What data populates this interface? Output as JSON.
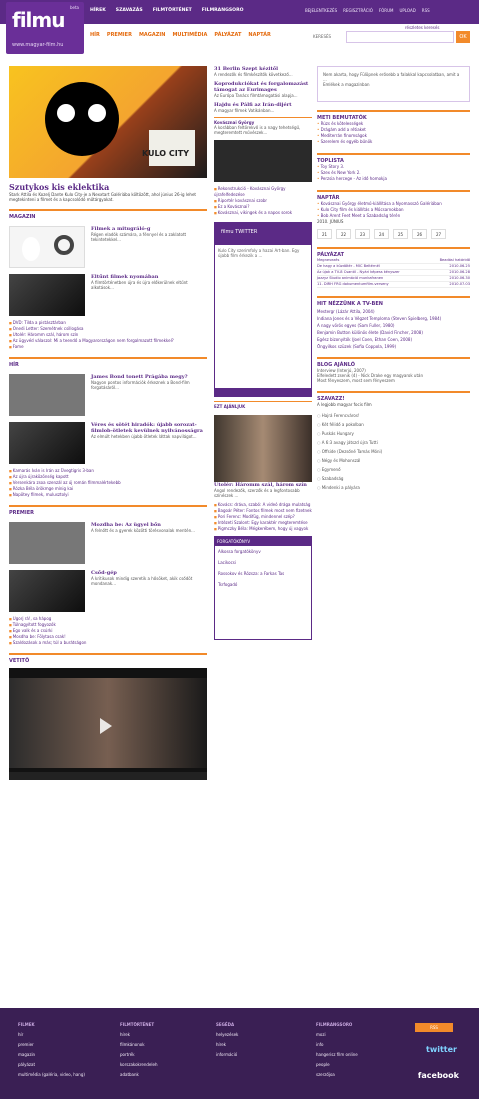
{
  "header": {
    "logo": "filmu",
    "logo_sub": "www.magyar-film.hu",
    "logo_small": "beta",
    "top_nav": [
      "HÍREK",
      "SZAVAZÁS",
      "FILMTÖRTÉNET",
      "FILMRANGSORO"
    ],
    "top_links": [
      "BEJELENTKEZÉS",
      "REGISZTRÁCIÓ",
      "FÓRUM",
      "UPLOAD",
      "RSS"
    ],
    "sub_nav": [
      "HÍR",
      "PREMIER",
      "MAGAZIN",
      "MULTIMÉDIA",
      "PÁLYÁZAT",
      "NAPTÁR"
    ],
    "search_label": "KERESÉS",
    "search_placeholder": "",
    "go": "OK",
    "mini": "részletes keresés"
  },
  "main": {
    "hero_tag": "KULO CITY",
    "hero_title": "Szutykos kis eklektika",
    "hero_text": "Stark Attila és Kozelj Dante Kulo City-je a Nexxtart Galériába költözött, ahol június 26-ig lehet megtekinteni a filmet és a kapcsolódó műtárgyakat.",
    "sec_magazin": "MAGAZIN",
    "magazin_items": [
      {
        "title": "Filmek a mitugráló-g",
        "text": "Régen eladók számára, a fénnyel és a zaklatott tekintetekkel..."
      },
      {
        "title": "Eltűnt filmek nyomában",
        "text": "A filmtörténetben újra és újra előkerülnek eltűnt alkotások..."
      }
    ],
    "magazin_list": [
      "DVD: Tilda a pistásztárban",
      "Onedi Letter: Szemétnek csillogása",
      "Utolér: Háromm szál, három szín",
      "Az ügyvéd válaszol: Mi a teendő a Magyarországon nem forgalmazott filmekkel?",
      "Fame"
    ],
    "sec_hir": "HÍR",
    "hir_items": [
      {
        "title": "James Bond tonett Prágába megy?",
        "text": "Nagyon pontos információk érkeznek a Bond-film forgatásáról..."
      },
      {
        "title": "Véres és sötét hiradók: újabb sorozat-filmlob-ötletek kevülnek nyilvánosságra",
        "text": "Az elmúlt hetekben újabb ötletek láttak napvilágot..."
      }
    ],
    "hir_list": [
      "Kamarás Iván is Irán az Üvegtigris 3-ban",
      "Az újra újraközönség kapott",
      "Versenkára zsoa szenzál az új román filmmalértekebb",
      "Rózka Béla örökmge mínig kai",
      "Napötey filmek, mulusztolyi"
    ],
    "sec_premier": "PREMIER",
    "premier_items": [
      {
        "title": "Mozdha be: Az ügyel bőn",
        "text": "A felnőtt és a gyerek közötti törésvonalak mentén..."
      },
      {
        "title": "Csőd-gép",
        "text": "A kritikusok mindig szeretik a hősöket, akik csődöt mondanak..."
      }
    ],
    "premier_list": [
      "Ugorj rá!, sa hápog",
      "Túlnagyított fogyozók",
      "Ego valk és a csúrki",
      "Mosdha be: Fölytasa csak!",
      "Szaldozások a más; túl a burátságon"
    ],
    "sec_video": "VETITŐ",
    "video_tag": "filmu TV"
  },
  "col2": {
    "hero_title": "Kovásznai György",
    "hero_text": "A korábban feltörekvő is a nagy tehetségű, megteremtett művészek...",
    "stories": [
      {
        "title": "31 Berlin Szept kézitől",
        "text": "A rendezők és filmkészítők következő..."
      },
      {
        "title": "Koprodukciókat és forgalomazást támogat az Eurimages",
        "text": "Az Európa Tanács filmtámogatási alapja..."
      },
      {
        "title": "Hajdu és Pálfi az Irán-dijért",
        "text": "A magyar filmek Vatikánban..."
      }
    ],
    "kovacsnai_list": [
      "Rekonstrukció - Kovásznai György újrafelfedezése",
      "Riportér kovásznai szobr",
      "Ez a Kovásznai?",
      "Kovásznai, vikingek és a napos sorok"
    ],
    "twitter_header": "filmu TWITTER",
    "twitter_text": "Kulo City szerimfoly a hazai Art-ban. Egy újabb film érkezik a ...",
    "sec_ezt_ajanljuk": "EZT AJÁNLJUK",
    "ezt_title": "Utolér: Háromm szál, három szín",
    "ezt_text": "Angol rendezők, szerzők és a legfontosabb színészek ...",
    "ezt_list": [
      "Kovács: dráva, szabó: A videó drága mulatság",
      "Bagoár Péter: Fontos filmek most nem fizetnek",
      "Pori Ferenc: Modifüg, mindennel szép?",
      "Intézeti Szalont: Egy karaktér megteremtése",
      "Pigmczky Béla: Mégkerébem, hogy új vagyok"
    ],
    "forg_header": "FORGATÓKÖNYV",
    "forg_rows": [
      "Alkossa forgatókönyv",
      "Lacikocsi",
      "Rossokov és Rózsza: a Farkas Tas",
      "Tsrfogadó"
    ]
  },
  "col3": {
    "intro": "Nem akarta, hogy Fülöpnek erősebb a falakkal kapcsolatban, amit a ...",
    "intro_link": "Emlékek a magazinban",
    "sec_meti": "METI BEMUTATÓK",
    "meti_list": [
      "Rúzs és kötelességek",
      "Drágám add a rétiaket",
      "Mediterrán finomságok",
      "Szerelem és egyéb bűnök"
    ],
    "sec_toplista": "TOPLISTA",
    "toplista": [
      "Toy Story 3.",
      "Szex és New York 2.",
      "Perzsia hercege - Az idő homokja"
    ],
    "sec_naptar": "NAPTÁR",
    "naptar_items": [
      {
        "title": "Kovásznai György életmű-kiállítása a Nyomasszó Galériában"
      },
      {
        "title": "Kulo City film és kiállítás a Műcsarnokban"
      },
      {
        "title": "Bob Arent Feet Meet a Szabadság térén"
      }
    ],
    "cal_month": "2010. JÚNIUS",
    "cal_days": [
      "21",
      "22",
      "23",
      "24",
      "25",
      "26",
      "27"
    ],
    "sec_palyazat": "PÁLYÁZAT",
    "palyazat": [
      [
        "Megnevezés",
        "Beadási határidő"
      ],
      [
        "De hagy a küzdőtér - MIC Beltérnél",
        "2010.06.25"
      ],
      [
        "Az újak a TV-8 Csantil - Nyári képess kényszer",
        "2010.06.28"
      ],
      [
        "Jazzyz Studio animáció munkafranen",
        "2010.06.30"
      ],
      [
        "11. DIRH FRG dokumentumfilm-verseny",
        "2010.07.03"
      ]
    ],
    "sec_tv": "HIT NÉZZÜNK A TV-BEN",
    "tv_list": [
      "Mestergr (Lázár Attila, 2004)",
      "Indiana Jones és a Végzet Templomа (Steven Spielberg, 1984)",
      "A nagy vörös egyes (Sam Fuller, 1980)",
      "Benjamin Button különös élete (David Fincher, 2008)",
      "Egész bizonyítók (Joel Coen, Ethan Coen, 2008)",
      "Öngyilkos szüzek (Sofia Coppola, 1999)"
    ],
    "sec_blog": "BLOG AJÁNLÓ",
    "blog_list": [
      "Interview (Interjú, 2007)",
      "Elfeledett zsenik (4) - Nick Drake egy magyarok után",
      "Most fényeszem, most sem fényeszem"
    ],
    "sec_szavazz": "SZAVAZZ!",
    "poll_title": "A legjobb magyar focis film",
    "poll_options": [
      "Hajrá Ferencváros!",
      "Két félidő a pokolban",
      "Puskás Hungary",
      "A 6:3 avagy játszd újra Tutti",
      "Offside (Dezsőné Tamás Móni)",
      "Négy és Mohonszál",
      "Egymenő",
      "Szabadság",
      "Mindenki a pályára"
    ]
  },
  "footer": {
    "cols": [
      {
        "head": "FILMEK",
        "items": [
          "hír",
          "premier",
          "magazin",
          "pályázat",
          "multimédia (galéria, video, hang)"
        ]
      },
      {
        "head": "FILMTÖRTÉNET",
        "items": [
          "hírek",
          "filmkánonok",
          "portrék",
          "korszakokrendeleh",
          "adatbank"
        ]
      },
      {
        "head": "SEGÉDA",
        "items": [
          "helyezések",
          "hírek",
          "információ"
        ]
      },
      {
        "head": "FILMRANGSORO",
        "items": [
          "mozi",
          "info",
          "hangerisz film online",
          "people",
          "szerzőjoa"
        ]
      }
    ],
    "rss": "RSS",
    "twitter": "twitter",
    "facebook": "facebook"
  }
}
